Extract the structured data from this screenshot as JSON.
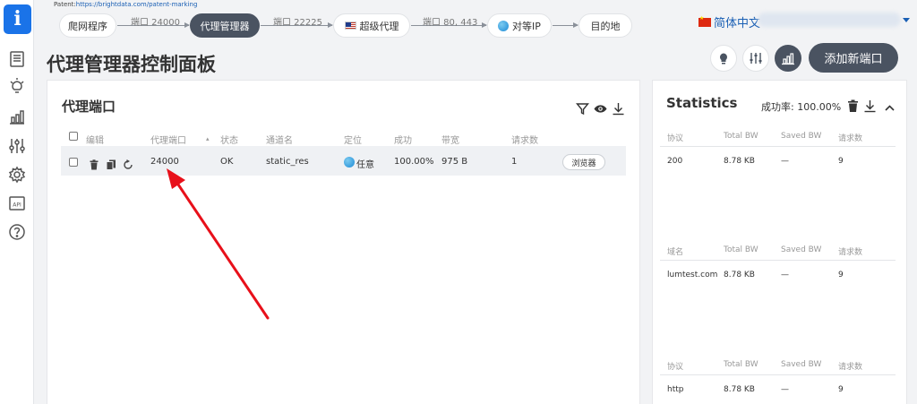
{
  "patent": {
    "label": "Patent:",
    "link": "https://brightdata.com/patent-marking"
  },
  "pipeline": {
    "steps": [
      "爬网程序",
      "代理管理器",
      "超级代理",
      "对等IP",
      "目的地"
    ],
    "connectors": [
      "端口 24000",
      "端口 22225",
      "端口 80, 443"
    ]
  },
  "language": {
    "label": "简体中文"
  },
  "page_title": "代理管理器控制面板",
  "header": {
    "add_port_label": "添加新端口"
  },
  "ports_panel": {
    "title": "代理端口",
    "columns": [
      "编辑",
      "代理端口",
      "状态",
      "通道名",
      "定位",
      "成功",
      "带宽",
      "请求数"
    ],
    "rows": [
      {
        "port": "24000",
        "status": "OK",
        "zone": "static_res",
        "location": "任意",
        "success": "100.00%",
        "bandwidth": "975 B",
        "requests": "1",
        "action": "浏览器"
      }
    ]
  },
  "stats": {
    "title": "Statistics",
    "success_label": "成功率: 100.00%",
    "sections": [
      {
        "columns": [
          "协议",
          "Total BW",
          "Saved BW",
          "请求数"
        ],
        "row": [
          "200",
          "8.78 KB",
          "—",
          "9"
        ]
      },
      {
        "columns": [
          "域名",
          "Total BW",
          "Saved BW",
          "请求数"
        ],
        "row": [
          "lumtest.com",
          "8.78 KB",
          "—",
          "9"
        ]
      },
      {
        "columns": [
          "协议",
          "Total BW",
          "Saved BW",
          "请求数"
        ],
        "row": [
          "http",
          "8.78 KB",
          "—",
          "9"
        ]
      }
    ]
  },
  "colors": {
    "accent": "#1a73e8",
    "dark_button": "#4a5361",
    "arrow": "#e8101a"
  }
}
